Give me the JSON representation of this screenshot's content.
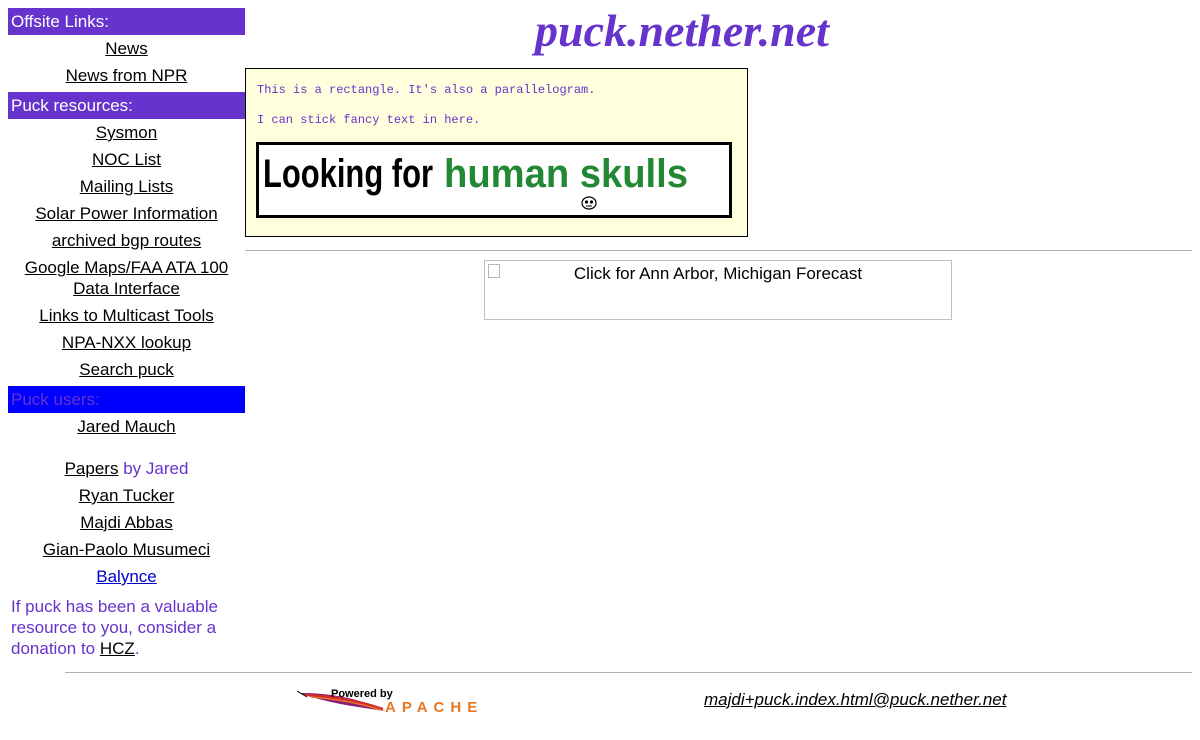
{
  "sidebar": {
    "offsite": {
      "header": "Offsite Links:",
      "header_color": "#6633cc",
      "links": [
        "News",
        "News from NPR"
      ]
    },
    "resources": {
      "header": "Puck resources:",
      "header_color": "#6633cc",
      "links": [
        "Sysmon",
        "NOC List",
        "Mailing Lists",
        "Solar Power Information",
        "archived bgp routes",
        "Google Maps/FAA ATA 100 Data Interface",
        "Links to Multicast Tools",
        "NPA-NXX lookup",
        "Search puck"
      ]
    },
    "users": {
      "header": "Puck users:",
      "header_color": "#0000ff",
      "header_text_color": "#6633cc",
      "jared": "Jared Mauch",
      "papers_link": "Papers",
      "papers_suffix": " by Jared",
      "others": [
        "Ryan Tucker",
        "Majdi Abbas",
        "Gian-Paolo Musumeci"
      ],
      "balynce": "Balynce",
      "balynce_color": "#0000cc"
    },
    "donate": {
      "text": "If puck has been a valuable resource to you, consider a donation to ",
      "link": "HCZ",
      "end": "."
    }
  },
  "main": {
    "title": "puck.nether.net",
    "box": {
      "line1": "This is a rectangle.  It's also a parallelogram.",
      "line2": "I can stick fancy text in here.",
      "banner_part1": "Looking for ",
      "banner_part2": "human skulls",
      "banner_accent": "#228833"
    },
    "forecast_alt": "Click for Ann Arbor, Michigan Forecast"
  },
  "footer": {
    "powered_by": "Powered by",
    "apache": "APACHE",
    "email": "majdi+puck.index.html@puck.nether.net"
  },
  "colors": {
    "accent_purple": "#6633cc",
    "box_background": "#ffffdd",
    "apache_orange": "#e87722"
  }
}
